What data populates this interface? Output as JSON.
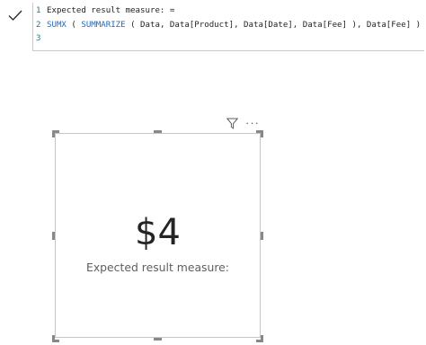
{
  "formula_bar": {
    "commit_icon": "checkmark-icon",
    "lines": [
      {
        "number": "1",
        "text": "Expected result measure: ="
      },
      {
        "number": "2",
        "function1": "SUMX",
        "mid1": " ( ",
        "function2": "SUMMARIZE",
        "rest": " ( Data, Data[Product], Data[Date], Data[Fee] ), Data[Fee] )"
      },
      {
        "number": "3",
        "text": ""
      }
    ]
  },
  "visual_header": {
    "filter_icon": "filter-icon",
    "more_options_icon": "more-options-icon",
    "more_options_glyph": "···"
  },
  "card": {
    "value": "$4",
    "label": "Expected result measure:"
  },
  "colors": {
    "line_number": "#237893",
    "function_keyword": "#1f69c2",
    "value_text": "#252423",
    "label_text": "#605e5c",
    "border": "#c8c6c4",
    "handle": "#8a8886"
  }
}
